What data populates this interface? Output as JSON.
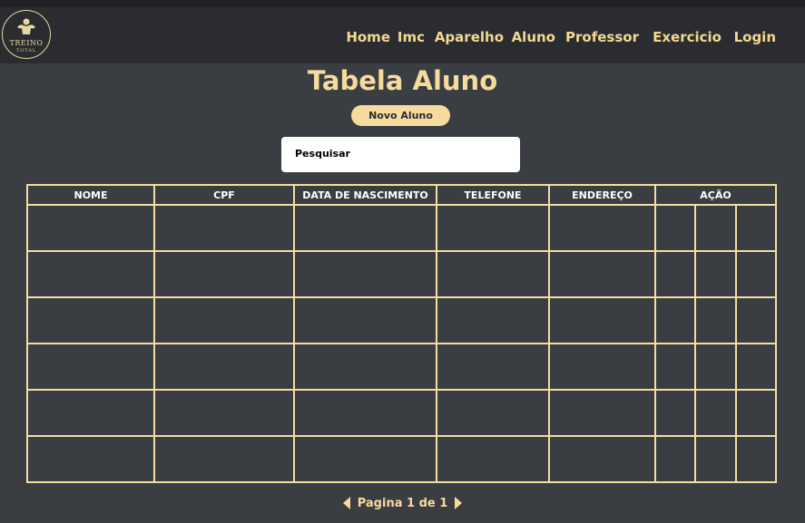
{
  "logo": {
    "line1": "TREINO",
    "line2": "TOTAL"
  },
  "nav": {
    "items": [
      {
        "label": "Home"
      },
      {
        "label": "Imc"
      },
      {
        "label": "Aparelho"
      },
      {
        "label": "Aluno"
      },
      {
        "label": "Professor"
      },
      {
        "label": "Exercicio"
      },
      {
        "label": "Login"
      }
    ]
  },
  "page": {
    "title": "Tabela Aluno"
  },
  "actions": {
    "new_label": "Novo Aluno"
  },
  "search": {
    "placeholder": "Pesquisar"
  },
  "table": {
    "columns": [
      "NOME",
      "CPF",
      "DATA DE NASCIMENTO",
      "TELEFONE",
      "ENDEREÇO",
      "AÇÃO"
    ],
    "rows": [
      [
        "",
        "",
        "",
        "",
        "",
        "",
        "",
        ""
      ],
      [
        "",
        "",
        "",
        "",
        "",
        "",
        "",
        ""
      ],
      [
        "",
        "",
        "",
        "",
        "",
        "",
        "",
        ""
      ],
      [
        "",
        "",
        "",
        "",
        "",
        "",
        "",
        ""
      ],
      [
        "",
        "",
        "",
        "",
        "",
        "",
        "",
        ""
      ],
      [
        "",
        "",
        "",
        "",
        "",
        "",
        "",
        ""
      ]
    ]
  },
  "pagination": {
    "text": "Pagina 1 de 1"
  },
  "colors": {
    "accent": "#f6dc9c",
    "background": "#3a3d42",
    "header": "#2a2c30"
  }
}
